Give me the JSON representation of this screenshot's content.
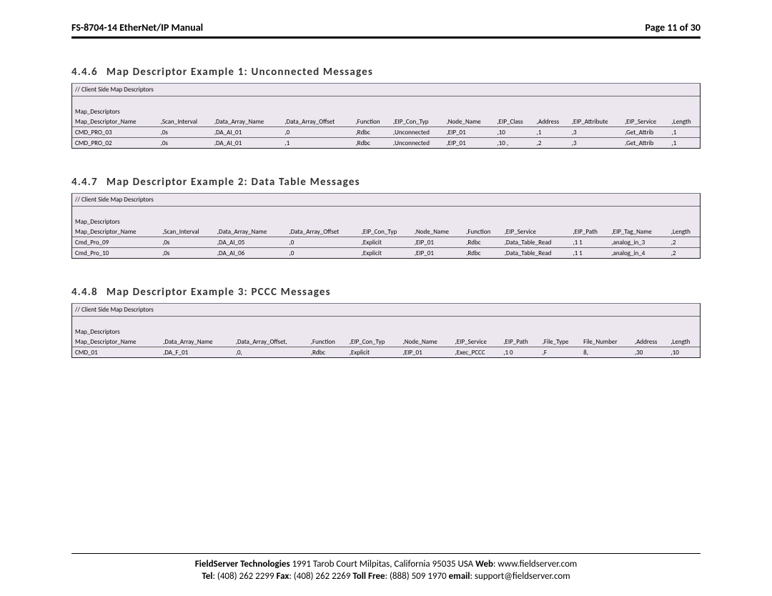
{
  "header": {
    "left": "FS-8704-14 EtherNet/IP Manual",
    "right": "Page 11 of 30"
  },
  "sections": [
    {
      "num": "4.4.6",
      "title": "Map Descriptor Example 1: Unconnected Messages",
      "comment": "//  Client Side Map Descriptors",
      "group": "Map_Descriptors",
      "head": [
        "Map_Descriptor_Name",
        ",Scan_Interval",
        ",Data_Array_Name",
        ",Data_Array_Offset",
        ",Function",
        ",EIP_Con_Typ",
        ",Node_Name",
        ",EIP_Class",
        ",Address",
        ",EIP_Attribute",
        ",EIP_Service",
        ",Length"
      ],
      "rows": [
        [
          "CMD_PRO_03",
          ",0s",
          ",DA_AI_01",
          ",0",
          ",Rdbc",
          ",Unconnected",
          ",EIP_01",
          ",10",
          ",1",
          ",3",
          ",Get_Attrib",
          ",1"
        ],
        [
          "CMD_PRO_02",
          ",0s",
          ",DA_AI_01",
          ",1",
          ",Rdbc",
          ",Unconnected",
          ",EIP_01",
          ",10       ,",
          ",2",
          ",3",
          ",Get_Attrib",
          ",1"
        ]
      ]
    },
    {
      "num": "4.4.7",
      "title": "Map Descriptor Example 2: Data Table Messages",
      "comment": "//  Client Side Map Descriptors",
      "group": "Map_Descriptors",
      "head": [
        "Map_Descriptor_Name",
        ",Scan_Interval",
        ",Data_Array_Name",
        ",Data_Array_Offset",
        ",EIP_Con_Typ",
        ",Node_Name",
        ",Function",
        ",EIP_Service",
        ",EIP_Path",
        ",EIP_Tag_Name",
        ",Length"
      ],
      "rows": [
        [
          "Cmd_Pro_09",
          ",0s",
          ",DA_AI_05",
          ",0",
          ",Explicit",
          ",EIP_01",
          ",Rdbc",
          ",Data_Table_Read",
          ",1 1",
          ",analog_in_3",
          ",2"
        ],
        [
          "Cmd_Pro_10",
          ",0s",
          ",DA_AI_06",
          ",0",
          ",Explicit",
          ",EIP_01",
          ",Rdbc",
          ",Data_Table_Read",
          ",1 1",
          ",analog_in_4",
          ",2"
        ]
      ]
    },
    {
      "num": "4.4.8",
      "title": "Map Descriptor Example 3: PCCC Messages",
      "comment": "//  Client Side Map Descriptors",
      "group": "Map_Descriptors",
      "head": [
        "Map_Descriptor_Name",
        ",Data_Array_Name",
        ",Data_Array_Offset,",
        ",Function",
        ",EIP_Con_Typ",
        ",Node_Name",
        ",EIP_Service",
        ",EIP_Path",
        ",File_Type",
        "File_Number",
        ",Address",
        ",Length"
      ],
      "rows": [
        [
          "CMD_01",
          ",DA_F_01",
          ",0,",
          ",Rdbc",
          ",Explicit",
          ",EIP_01",
          ",Exec_PCCC",
          ",1 0",
          ",F",
          "8,",
          ",30",
          ",10"
        ]
      ]
    }
  ],
  "footer": {
    "line1a": "FieldServer Technologies",
    "line1b": " 1991 Tarob Court Milpitas, California 95035 USA  ",
    "line1c": "Web",
    "line1d": ": www.fieldserver.com",
    "line2a": "Tel",
    "line2b": ": (408) 262 2299  ",
    "line2c": "Fax",
    "line2d": ": (408) 262 2269  ",
    "line2e": "Toll Free",
    "line2f": ": (888) 509 1970   ",
    "line2g": "email",
    "line2h": ": support@fieldserver.com"
  }
}
